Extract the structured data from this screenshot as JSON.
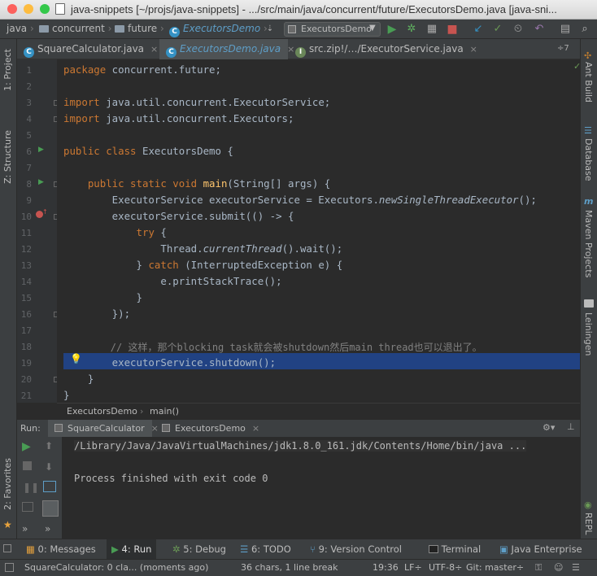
{
  "window": {
    "title": "java-snippets [~/projs/java-snippets] - .../src/main/java/concurrent/future/ExecutorsDemo.java [java-sni..."
  },
  "nav": {
    "crumbs": [
      "java",
      "concurrent",
      "future",
      "ExecutorsDemo"
    ],
    "run_config": "ExecutorsDemo"
  },
  "left_tools": {
    "project": "1: Project",
    "structure": "Z: Structure",
    "favorites": "2: Favorites"
  },
  "right_tools": {
    "ant": "Ant Build",
    "database": "Database",
    "maven": "Maven Projects",
    "leiningen": "Leiningen",
    "repl": "REPL"
  },
  "tabs": [
    {
      "label": "SquareCalculator.java"
    },
    {
      "label": "ExecutorsDemo.java"
    },
    {
      "label": "src.zip!/…/ExecutorService.java"
    }
  ],
  "tabs_overflow": "÷7",
  "code_lines": {
    "n1": "1",
    "n2": "2",
    "n3": "3",
    "n4": "4",
    "n5": "5",
    "n6": "6",
    "n7": "7",
    "n8": "8",
    "n9": "9",
    "n10": "10",
    "n11": "11",
    "n12": "12",
    "n13": "13",
    "n14": "14",
    "n15": "15",
    "n16": "16",
    "n17": "17",
    "n18": "18",
    "n19": "19",
    "n20": "20",
    "n21": "21"
  },
  "code": {
    "l1a": "package",
    "l1b": " concurrent.future;",
    "l3a": "import",
    "l3b": " java.util.concurrent.ExecutorService;",
    "l4a": "import",
    "l4b": " java.util.concurrent.Executors;",
    "l6a": "public class",
    "l6b": " ExecutorsDemo {",
    "l8a": "    public static void ",
    "l8b": "main",
    "l8c": "(String[] args) {",
    "l9a": "        ExecutorService executorService = Executors.",
    "l9b": "newSingleThreadExecutor",
    "l9c": "();",
    "l10": "        executorService.submit(() -> {",
    "l11a": "            ",
    "l11b": "try",
    "l11c": " {",
    "l12a": "                Thread.",
    "l12b": "currentThread",
    "l12c": "().wait();",
    "l13a": "            } ",
    "l13b": "catch",
    "l13c": " (InterruptedException e) {",
    "l14": "                e.printStackTrace();",
    "l15": "            }",
    "l16": "        });",
    "l18": "        // 这样，那个blocking task就会被shutdown然后main thread也可以退出了。",
    "l19": "        executorService.shutdown();",
    "l20": "    }",
    "l21": "}"
  },
  "editor_breadcrumb": [
    "ExecutorsDemo",
    "main()"
  ],
  "run_panel": {
    "label": "Run:",
    "tabs": [
      "SquareCalculator",
      "ExecutorsDemo"
    ],
    "console_line1": "/Library/Java/JavaVirtualMachines/jdk1.8.0_161.jdk/Contents/Home/bin/java ...",
    "console_line2": "Process finished with exit code 0"
  },
  "bottom_tools": [
    {
      "label": "0: Messages"
    },
    {
      "label": "4: Run"
    },
    {
      "label": "5: Debug"
    },
    {
      "label": "6: TODO"
    },
    {
      "label": "9: Version Control"
    },
    {
      "label": "Terminal"
    },
    {
      "label": "Java Enterprise"
    }
  ],
  "status": {
    "message": "SquareCalculator: 0 cla... (moments ago)",
    "selection": "36 chars, 1 line break",
    "position": "19:36",
    "line_sep": "LF÷",
    "encoding": "UTF-8÷",
    "git": "Git: master÷"
  },
  "colors": {
    "keyword": "#cc7832",
    "method": "#ffc66d",
    "selection": "#214283",
    "run_green": "#499c54"
  }
}
